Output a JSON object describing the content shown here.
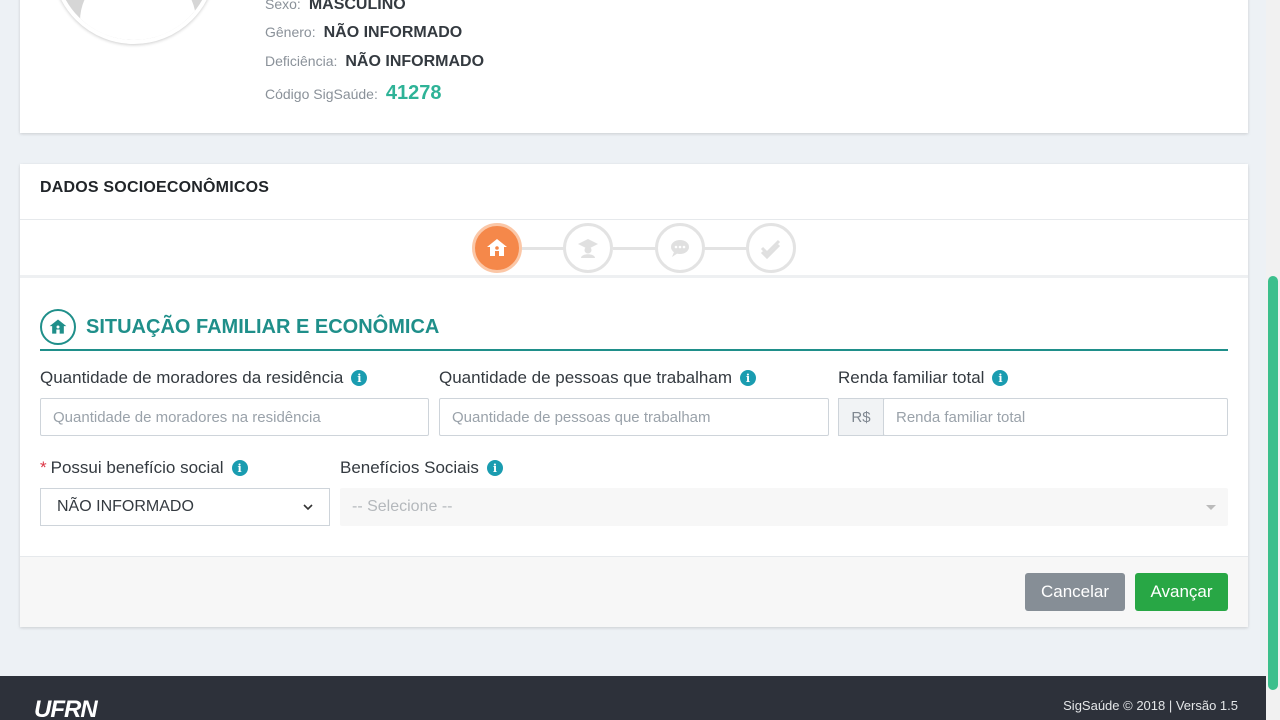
{
  "profile": {
    "sexo_label": "Sexo:",
    "sexo_value": "MASCULINO",
    "genero_label": "Gênero:",
    "genero_value": "NÃO INFORMADO",
    "deficiencia_label": "Deficiência:",
    "deficiencia_value": "NÃO INFORMADO",
    "codigo_label": "Código SigSaúde:",
    "codigo_value": "41278"
  },
  "card": {
    "title": "DADOS SOCIOECONÔMICOS",
    "steps": [
      "home-icon",
      "graduation-icon",
      "chat-icon",
      "check-icon"
    ],
    "active_step": 0,
    "section_title": "SITUAÇÃO FAMILIAR E ECONÔMICA"
  },
  "form": {
    "moradores_label": "Quantidade de moradores da residência",
    "moradores_placeholder": "Quantidade de moradores na residência",
    "trabalham_label": "Quantidade de pessoas que trabalham",
    "trabalham_placeholder": "Quantidade de pessoas que trabalham",
    "renda_label": "Renda familiar total",
    "renda_addon": "R$",
    "renda_placeholder": "Renda familiar total",
    "beneficio_required": "*",
    "beneficio_label": "Possui benefício social",
    "beneficio_value": "NÃO INFORMADO",
    "beneficios_label": "Benefícios Sociais",
    "beneficios_placeholder": "-- Selecione --",
    "info_glyph": "i"
  },
  "actions": {
    "cancel_label": "Cancelar",
    "next_label": "Avançar"
  },
  "footer": {
    "logo": "UFRN",
    "copyright": "SigSaúde © 2018 | Versão 1.5"
  },
  "colors": {
    "accent": "#1f8f8a",
    "step_active": "#f5884a",
    "info": "#1a9cb0",
    "success": "#28a745",
    "code": "#2eb397"
  }
}
